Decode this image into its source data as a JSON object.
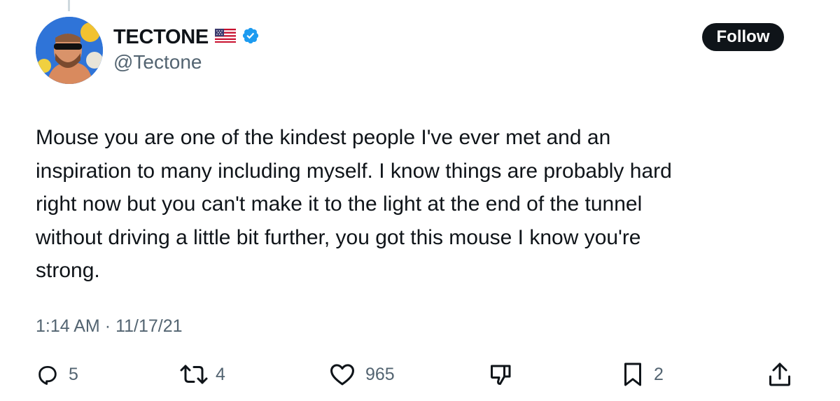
{
  "author": {
    "display_name": "TECTONE",
    "handle": "@Tectone",
    "flag_icon": "us-flag-icon",
    "verified_icon": "verified-badge-icon",
    "verified_color": "#1d9bf0"
  },
  "follow_button": {
    "label": "Follow"
  },
  "tweet": {
    "lines": [
      "Mouse you are one of the kindest people I've ever met and an",
      "inspiration to many including myself. I know things are probably hard",
      "right now but you can't make it to the light at the end of the tunnel",
      "without driving a little bit further, you got this mouse I know you're",
      "strong."
    ],
    "time": "1:14 AM",
    "separator": "·",
    "date": "11/17/21"
  },
  "actions": {
    "reply": {
      "icon": "reply-icon",
      "count": "5"
    },
    "retweet": {
      "icon": "retweet-icon",
      "count": "4"
    },
    "like": {
      "icon": "heart-icon",
      "count": "965"
    },
    "dislike": {
      "icon": "thumbs-down-icon",
      "count": ""
    },
    "bookmark": {
      "icon": "bookmark-icon",
      "count": "2"
    },
    "share": {
      "icon": "share-icon",
      "count": ""
    }
  },
  "colors": {
    "text_primary": "#0f1419",
    "text_secondary": "#536471",
    "follow_bg": "#0f1419"
  }
}
